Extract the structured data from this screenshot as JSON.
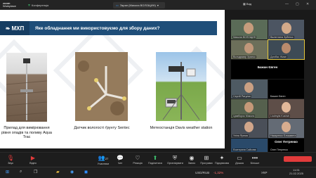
{
  "app": {
    "brand_top": "zoom",
    "brand_bottom": "Workplace",
    "conference_label": "Конференція"
  },
  "share_pill": {
    "label": "Экран (Микола ВОЛОЩИН)"
  },
  "view_label": "Вид",
  "slide": {
    "logo": "МХП",
    "title": "Яке обладнання ми використовуємо для збору даних?",
    "items": [
      {
        "caption": "Прилад для вимірювання рівня опадів та поливу Aqua Trac"
      },
      {
        "caption": "Датчик вологості ґрунту Sentec"
      },
      {
        "caption": "Метеостанція Davis weather station"
      }
    ]
  },
  "participants": [
    {
      "name": "Микола ВОЛОЩИН"
    },
    {
      "name": "Валентина Зубенко"
    },
    {
      "name": "Володимир Хрипко"
    },
    {
      "name": "Дзюбас Жиан"
    },
    {
      "name": "Бажан Євген",
      "big": true
    },
    {
      "name": "Сергій Ратулин"
    },
    {
      "name": "Бажан Євген"
    },
    {
      "name": "Цимборок Микола"
    },
    {
      "name": "Liudmyla Kushch"
    },
    {
      "name": "Уліна Ярема"
    },
    {
      "name": "Назаренко Єлизавета"
    },
    {
      "name": "Олег Петренко",
      "big": true
    },
    {
      "name": "Екатерина Сайкова"
    },
    {
      "name": "Олег Петренко"
    }
  ],
  "toolbar": {
    "audio": "Звук",
    "video": "Відео",
    "participants": "Учасники",
    "participants_count": "27",
    "chat": "Чат",
    "react": "Реакція",
    "share": "Поділитися",
    "host": "Організувати",
    "record": "Запис",
    "apps": "Програми",
    "summary": "Підсумкова",
    "whiteboard": "Дошка",
    "more": "Більше"
  },
  "taskbar": {
    "ticker": "USD/RUB",
    "ticker_change": "-1,32%",
    "time": "11:51",
    "date": "21.02.2025",
    "lang": "УКР"
  }
}
